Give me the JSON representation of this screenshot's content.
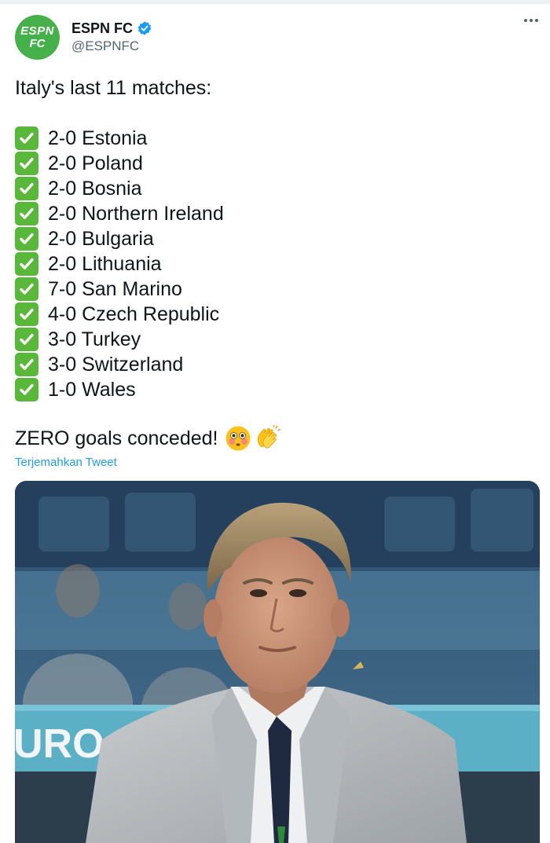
{
  "account": {
    "avatar_line1": "ESPN",
    "avatar_line2": "FC",
    "display_name": "ESPN FC",
    "handle": "@ESPNFC"
  },
  "tweet": {
    "intro": "Italy's last 11 matches:",
    "matches": [
      "2-0 Estonia",
      "2-0 Poland",
      "2-0 Bosnia",
      "2-0 Northern Ireland",
      "2-0 Bulgaria",
      "2-0 Lithuania",
      "7-0 San Marino",
      "4-0 Czech Republic",
      "3-0 Turkey",
      "3-0 Switzerland",
      "1-0 Wales"
    ],
    "closing": "ZERO goals conceded!",
    "closing_emojis": [
      "flushed-face-emoji",
      "clapping-hands-emoji"
    ],
    "translate_label": "Terjemahkan Tweet"
  },
  "photo": {
    "banner_text": "URO"
  },
  "colors": {
    "brand_green": "#46b04b",
    "check_green": "#59b73a",
    "link_blue": "#1d9bf0",
    "secondary_text": "#536471"
  }
}
